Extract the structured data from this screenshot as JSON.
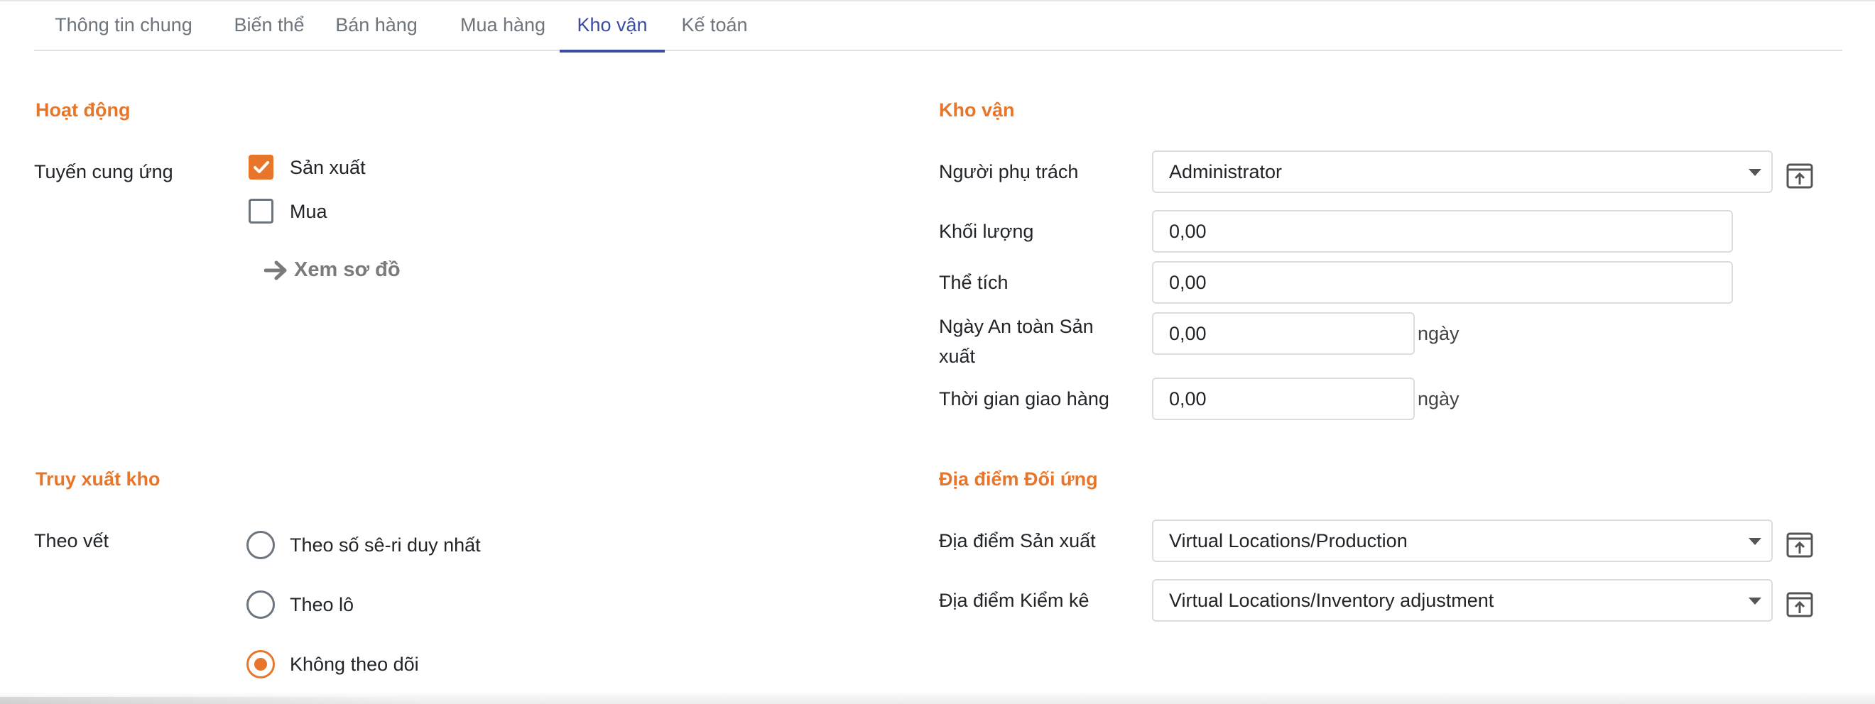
{
  "tabs": [
    {
      "label": "Thông tin chung",
      "active": false
    },
    {
      "label": "Biến thể",
      "active": false
    },
    {
      "label": "Bán hàng",
      "active": false
    },
    {
      "label": "Mua hàng",
      "active": false
    },
    {
      "label": "Kho vận",
      "active": true
    },
    {
      "label": "Kế toán",
      "active": false
    }
  ],
  "operations": {
    "title": "Hoạt động",
    "routes_label": "Tuyến cung ứng",
    "routes": [
      {
        "label": "Sản xuất",
        "checked": true
      },
      {
        "label": "Mua",
        "checked": false
      }
    ],
    "view_diagram": "Xem sơ đồ"
  },
  "logistics": {
    "title": "Kho vận",
    "responsible": {
      "label": "Người phụ trách",
      "value": "Administrator"
    },
    "weight": {
      "label": "Khối lượng",
      "value": "0,00"
    },
    "volume": {
      "label": "Thể tích",
      "value": "0,00"
    },
    "manufacturing_lead": {
      "label": "Ngày An toàn Sản xuất",
      "value": "0,00",
      "unit": "ngày"
    },
    "delivery_lead": {
      "label": "Thời gian giao hàng",
      "value": "0,00",
      "unit": "ngày"
    }
  },
  "traceability": {
    "title": "Truy xuất kho",
    "tracking_label": "Theo vết",
    "options": [
      {
        "label": "Theo số sê-ri duy nhất",
        "checked": false
      },
      {
        "label": "Theo lô",
        "checked": false
      },
      {
        "label": "Không theo dõi",
        "checked": true
      }
    ]
  },
  "counterpart": {
    "title": "Địa điểm Đối ứng",
    "production": {
      "label": "Địa điểm Sản xuất",
      "value": "Virtual Locations/Production"
    },
    "inventory": {
      "label": "Địa điểm Kiểm kê",
      "value": "Virtual Locations/Inventory adjustment"
    }
  },
  "colors": {
    "accent": "#e8762a",
    "tab_active": "#3b4da3"
  },
  "icons": {
    "checkmark": "check-icon",
    "arrow": "arrow-right-icon",
    "external": "external-link-icon",
    "caret": "caret-down-icon"
  }
}
